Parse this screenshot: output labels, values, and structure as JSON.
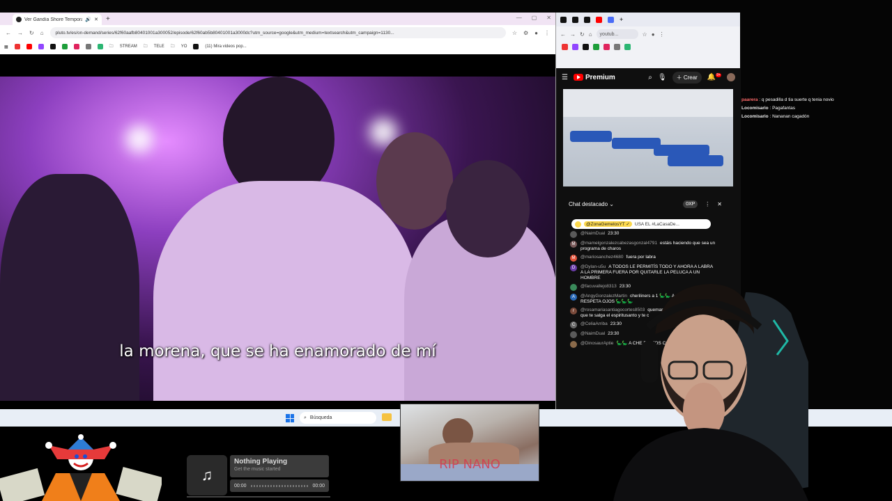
{
  "left_browser": {
    "tab_title": "Ver Gandía Shore Tempora",
    "url": "pluto.tv/es/on-demand/series/62f60aafb80401001a300052/episode/62f60ab5b80401001a3000dc?utm_source=google&utm_medium=textsearch&utm_campaign=1130...",
    "bookmarks": [
      "STREAM",
      "TELE",
      "YO",
      "(11) Mira videos pop..."
    ],
    "subtitle": "la morena, que se ha enamorado de mí"
  },
  "right_browser": {
    "address": "youtub...",
    "premium_label": "Premium",
    "create_label": "Crear",
    "notif_count": "9+",
    "chat_title": "Chat destacado",
    "xp_label": "0XP",
    "pinned_user": "@ZonaGemelosYT ✓",
    "pinned_text": "USA EL #LaCasaDe...",
    "messages": [
      {
        "avatar": "",
        "color": "#5a5a5a",
        "user": "@NaimDual",
        "text": "23:30"
      },
      {
        "avatar": "M",
        "color": "#7a5a5a",
        "user": "@mamelgonzalezcabezasgonzal4791",
        "text": "estáis haciendo que sea un programa de charos"
      },
      {
        "avatar": "M",
        "color": "#e0533b",
        "user": "@mariosanchez4680",
        "text": "fuera por labra"
      },
      {
        "avatar": "D",
        "color": "#6a3ca8",
        "user": "@Dylan-u5u",
        "text": "A TODOS LE PERMITÍS TODO Y AHORA A LABRA A LA PRIMERA FUERA POR QUITARLE LA PELUCA A UN HOMBRE"
      },
      {
        "avatar": "",
        "color": "#3a8a5a",
        "user": "@facuvallejo8313",
        "text": "23:30"
      },
      {
        "avatar": "A",
        "color": "#2a6ab8",
        "user": "@AngyGonzalezMartin",
        "text": "cheriliners a 1 🦕🦕 A CHERILYN LA RESPETA OJOS 🦕🦕🦕"
      },
      {
        "avatar": "r",
        "color": "#7a4a3a",
        "user": "@rosamariasantiagocortes8503",
        "text": "quemar la biblia ten cuidado está que te salga el espiritusanto y te c"
      },
      {
        "avatar": "C",
        "color": "#6a6a6a",
        "user": "@CeliaArriba",
        "text": "23:30"
      },
      {
        "avatar": "",
        "color": "#5a5a5a",
        "user": "@NaimDual",
        "text": "23:30"
      },
      {
        "avatar": "",
        "color": "#8a6a4a",
        "user": "@DinosaurAptie",
        "text": "🦕🦕 A CHE BULTOS CON OJOS 🦕🦕"
      }
    ]
  },
  "overlay_chat": [
    {
      "user": "paarera",
      "text": "q pesadilla d tia suerte q tenia novio",
      "color": "#ff6b6b"
    },
    {
      "user": "Locomisario",
      "text": "Pagafantas",
      "color": "#eee"
    },
    {
      "user": "Locomisario",
      "text": "Nananan cagadón",
      "color": "#eee"
    }
  ],
  "taskbar": {
    "search_placeholder": "Búsqueda"
  },
  "now_playing": {
    "title": "Nothing Playing",
    "subtitle": "Get the music started",
    "time_start": "00:00",
    "time_end": "00:00"
  },
  "rip_image": {
    "caption": "RIP NANO"
  }
}
